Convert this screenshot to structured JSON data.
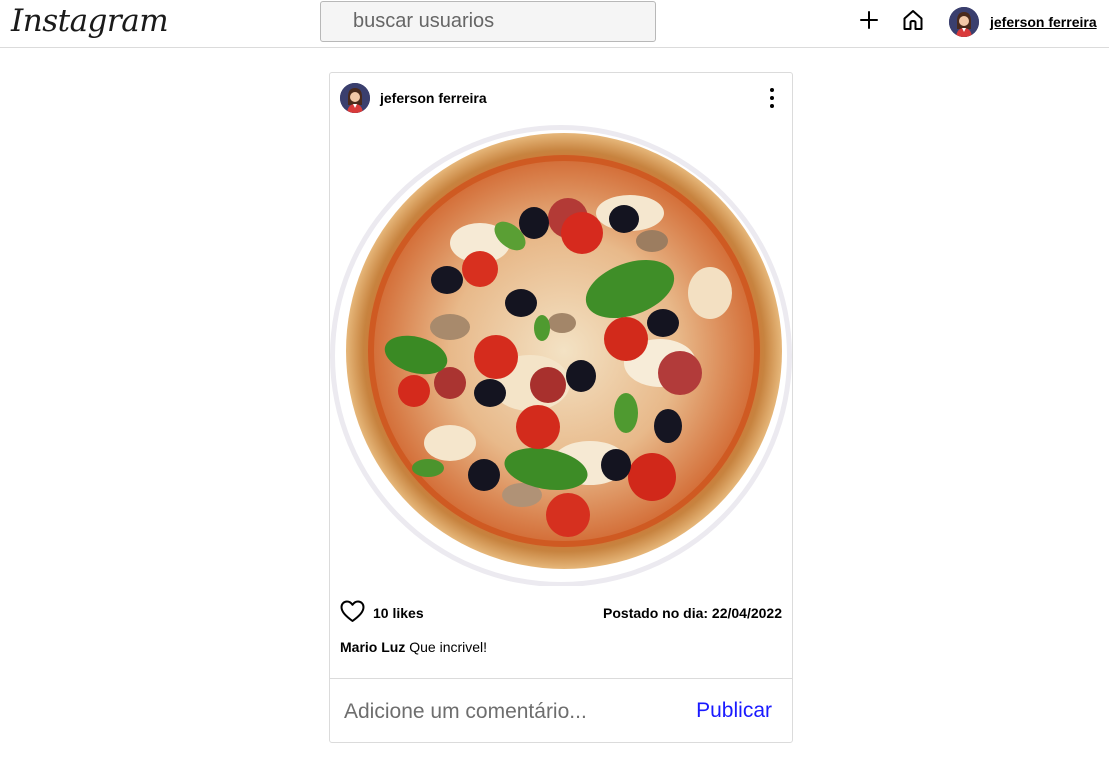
{
  "header": {
    "logo": "Instagram",
    "search_placeholder": "buscar usuarios",
    "icons": {
      "add": "plus-icon",
      "home": "home-icon"
    },
    "user": {
      "name": "jeferson ferreira",
      "avatar": "avatar-illustration"
    }
  },
  "post": {
    "author": "jeferson ferreira",
    "author_avatar": "avatar-illustration",
    "menu_icon": "more-vertical-icon",
    "image": "pizza",
    "like_icon": "heart-icon",
    "likes": "10 likes",
    "date": "Postado no dia: 22/04/2022",
    "comments": [
      {
        "author": "Mario Luz",
        "text": "Que incrivel!"
      }
    ],
    "comment_placeholder": "Adicione um comentário...",
    "publish_label": "Publicar"
  },
  "colors": {
    "border": "#dbdbdb",
    "publish": "#1a1aff",
    "avatar_bg": "#3a3f6e"
  }
}
